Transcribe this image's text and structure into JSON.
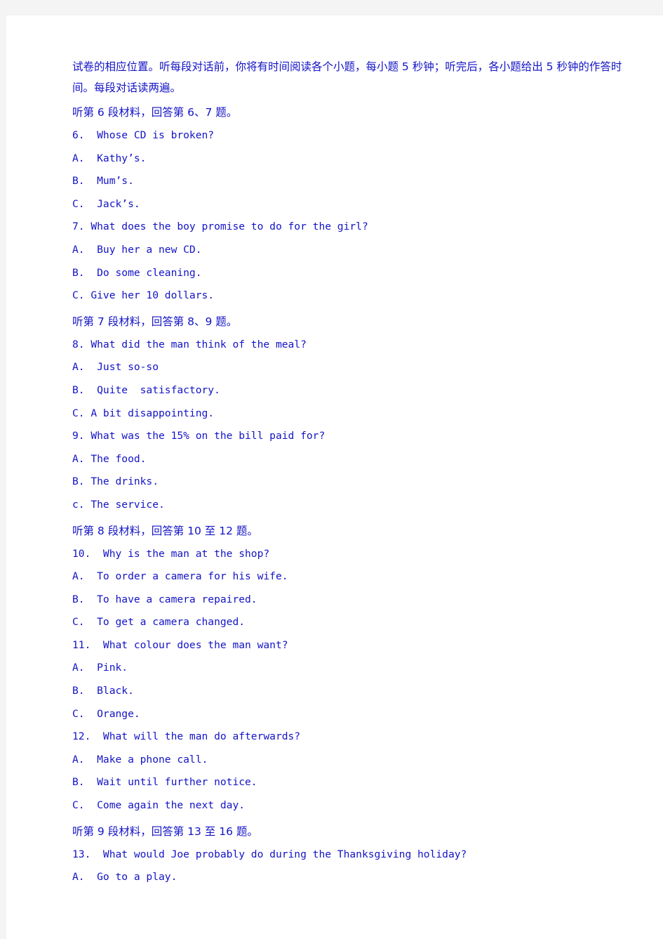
{
  "document": {
    "type": "english-listening-exam-paper",
    "text_color": "#1313c6",
    "page_background": "#ffffff",
    "canvas_background": "#f4f4f4"
  },
  "intro": {
    "paragraph": "试卷的相应位置。听每段对话前，你将有时间阅读各个小题，每小题 5 秒钟；听完后，各小题给出 5 秒钟的作答时间。每段对话读两遍。"
  },
  "sections": [
    {
      "header": "听第 6 段材料，回答第 6、7 题。",
      "questions": [
        {
          "number": "6.",
          "text": "6.  Whose CD is broken?",
          "options": [
            "A.  Kathy’s.",
            "B.  Mum’s.",
            "C.  Jack’s."
          ]
        },
        {
          "number": "7.",
          "text": "7. What does the boy promise to do for the girl?",
          "options": [
            "A.  Buy her a new CD.",
            "B.  Do some cleaning.",
            "C. Give her 10 dollars."
          ]
        }
      ]
    },
    {
      "header": "听第 7 段材料，回答第 8、9 题。",
      "questions": [
        {
          "number": "8.",
          "text": "8. What did the man think of the meal?",
          "options": [
            "A.  Just so-so",
            "B.  Quite  satisfactory.",
            "C. A bit disappointing."
          ]
        },
        {
          "number": "9.",
          "text": "9. What was the 15% on the bill paid for?",
          "options": [
            "A. The food.",
            "B. The drinks.",
            "c. The service."
          ]
        }
      ]
    },
    {
      "header": "听第 8 段材料，回答第 10 至 12 题。",
      "questions": [
        {
          "number": "10.",
          "text": "10.  Why is the man at the shop?",
          "options": [
            "A.  To order a camera for his wife.",
            "B.  To have a camera repaired.",
            "C.  To get a camera changed."
          ]
        },
        {
          "number": "11.",
          "text": "11.  What colour does the man want?",
          "options": [
            "A.  Pink.",
            "B.  Black.",
            "C.  Orange."
          ]
        },
        {
          "number": "12.",
          "text": "12.  What will the man do afterwards?",
          "options": [
            "A.  Make a phone call.",
            "B.  Wait until further notice.",
            "C.  Come again the next day."
          ]
        }
      ]
    },
    {
      "header": "听第 9 段材料，回答第 13 至 16 题。",
      "questions": [
        {
          "number": "13.",
          "text": "13.  What would Joe probably do during the Thanksgiving holiday?",
          "options": [
            "A.  Go to a play."
          ]
        }
      ]
    }
  ]
}
